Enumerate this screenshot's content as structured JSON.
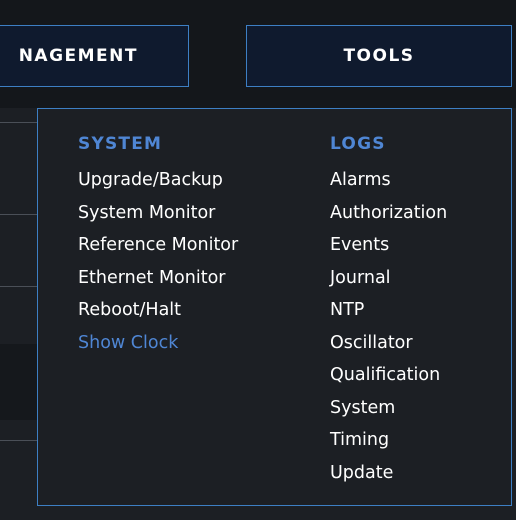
{
  "nav": {
    "management_label": "NAGEMENT",
    "tools_label": "TOOLS"
  },
  "menu": {
    "system": {
      "heading": "SYSTEM",
      "items": [
        {
          "label": "Upgrade/Backup"
        },
        {
          "label": "System Monitor"
        },
        {
          "label": "Reference Monitor"
        },
        {
          "label": "Ethernet Monitor"
        },
        {
          "label": "Reboot/Halt"
        },
        {
          "label": "Show Clock"
        }
      ]
    },
    "logs": {
      "heading": "LOGS",
      "items": [
        {
          "label": "Alarms"
        },
        {
          "label": "Authorization"
        },
        {
          "label": "Events"
        },
        {
          "label": "Journal"
        },
        {
          "label": "NTP"
        },
        {
          "label": "Oscillator"
        },
        {
          "label": "Qualification"
        },
        {
          "label": "System"
        },
        {
          "label": "Timing"
        },
        {
          "label": "Update"
        }
      ]
    }
  },
  "colors": {
    "accent": "#4f86d4",
    "border": "#3d7fc4",
    "panel_bg": "#1c1f24",
    "nav_bg": "#0f1a2e"
  }
}
